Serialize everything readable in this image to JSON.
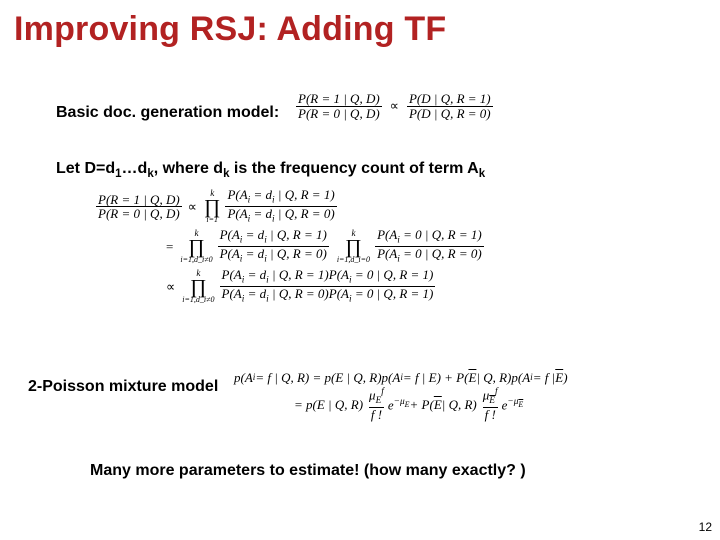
{
  "title": "Improving RSJ: Adding TF",
  "lines": {
    "basic_model": "Basic doc. generation model:",
    "let_d": "Let D=d",
    "let_d_sub1": "1",
    "let_d_mid1": "…d",
    "let_d_subk": "k",
    "let_d_mid2": ", where d",
    "let_d_subk2": "k",
    "let_d_mid3": " is the frequency count of term  A",
    "let_d_subk3": "k",
    "mixture": "2-Poisson mixture model",
    "conclusion": "Many more parameters to estimate! (how many exactly? )"
  },
  "math1": {
    "num1": "P(R = 1 | Q, D)",
    "den1": "P(R = 0 | Q, D)",
    "num2": "P(D | Q, R = 1)",
    "den2": "P(D | Q, R = 0)"
  },
  "math2": {
    "lhs_num": "P(R = 1 | Q, D)",
    "lhs_den": "P(R = 0 | Q, D)",
    "r1_prod_top": "k",
    "r1_prod_bot": "i=1",
    "r1_num": "P(A",
    "r1_sub": "i",
    "r1_mid": " = d",
    "r1_end": " | Q, R = 1)",
    "r1_den_end": " | Q, R = 0)",
    "r2_eq": "=",
    "r2_prod1_top": "k",
    "r2_prod1_bot": "i=1,d_i≠0",
    "r2_f1_num": "P(A",
    "r2_f1_end1": " | Q, R = 1)",
    "r2_f1_end0": " | Q, R = 0)",
    "r2_prod2_top": "k",
    "r2_prod2_bot": "i=1,d_i=0",
    "r2_f2_numA": "P(A",
    "r2_f2_eq0": " = 0 | Q, R = 1)",
    "r2_f2_eq0d": " = 0 | Q, R = 0)",
    "r3_prop": "∝",
    "r3_prod_top": "k",
    "r3_prod_bot": "i=1,d_i≠0",
    "r3_numA": "P(A",
    "r3_q1": " | Q, R = 1)P(A",
    "r3_q1b": " = 0 | Q, R = 1)",
    "r3_q0": " | Q, R = 0)P(A",
    "r3_q0b": " = 0 | Q, R = 1)"
  },
  "math3": {
    "lhs1": "p(A",
    "lhs2": " = f | Q, R) = p(E | Q, R)p(A",
    "lhs3": " = f | E) + P(",
    "lhs4": " | Q, R)p(A",
    "lhs5": " = f | ",
    "lhs6": ")",
    "Ebar": "E",
    "r2_eq": "= p(E | Q, R)",
    "r2_mid": "e",
    "r2_exp1": "−μ",
    "r2_exp1s": "E",
    "r2_plus": " + P(",
    "r2_after": " | Q, R)",
    "r2_exp2": "−μ",
    "r2_exp2s": "E",
    "mu": "μ",
    "f": "f",
    "fact": "f !"
  },
  "page_number": "12"
}
